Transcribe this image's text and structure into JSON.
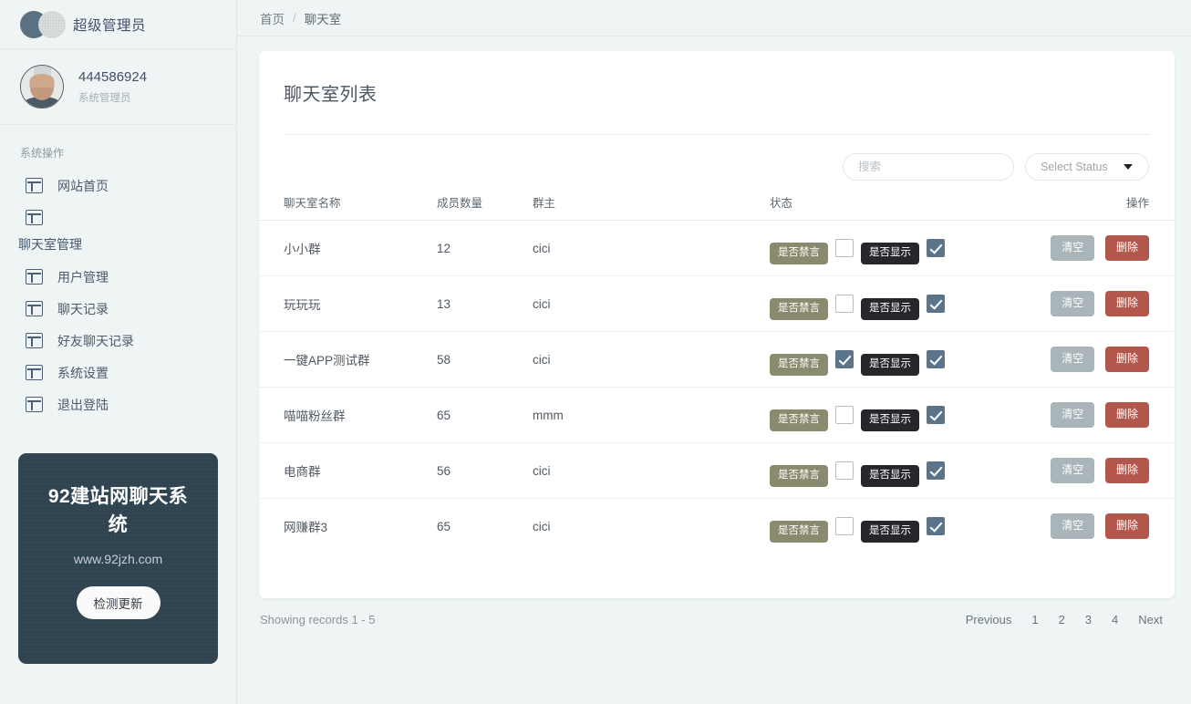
{
  "sidebar": {
    "brand": {
      "name": "超级管理员",
      "logo_icon": "two-circles-logo"
    },
    "user": {
      "id": "444586924",
      "role": "系统管理员",
      "avatar_icon": "user-photo-avatar"
    },
    "group1_title": "系统操作",
    "group2_title": "聊天室管理",
    "items_top": [
      {
        "label": "网站首页",
        "icon": "layout-icon"
      },
      {
        "label": "",
        "icon": "layout-icon"
      }
    ],
    "items_bottom": [
      {
        "label": "用户管理",
        "icon": "layout-icon"
      },
      {
        "label": "聊天记录",
        "icon": "layout-icon"
      },
      {
        "label": "好友聊天记录",
        "icon": "layout-icon"
      },
      {
        "label": "系统设置",
        "icon": "layout-icon"
      },
      {
        "label": "退出登陆",
        "icon": "layout-icon"
      }
    ],
    "promo": {
      "title": "92建站网聊天系统",
      "url": "www.92jzh.com",
      "button": "检测更新",
      "bg_color": "#2f4450"
    }
  },
  "breadcrumb": {
    "home": "首页",
    "sep": "/",
    "current": "聊天室"
  },
  "card": {
    "title": "聊天室列表",
    "search": {
      "value": "",
      "placeholder": "搜索"
    },
    "status_filter": {
      "selected": "Select Status",
      "icon": "chevron-down-icon"
    },
    "columns": [
      "聊天室名称",
      "成员数量",
      "群主",
      "状态",
      "操作"
    ],
    "row_actions": {
      "mute_label": "是否禁言",
      "show_label": "是否显示",
      "clear_label": "清空",
      "delete_label": "删除"
    },
    "rows": [
      {
        "name": "小小群",
        "members": "12",
        "owner": "cici",
        "muted": false,
        "shown": true
      },
      {
        "name": "玩玩玩",
        "members": "13",
        "owner": "cici",
        "muted": false,
        "shown": true
      },
      {
        "name": "一键APP测试群",
        "members": "58",
        "owner": "cici",
        "muted": true,
        "shown": true
      },
      {
        "name": "喵喵粉丝群",
        "members": "65",
        "owner": "mmm",
        "muted": false,
        "shown": true
      },
      {
        "name": "电商群",
        "members": "56",
        "owner": "cici",
        "muted": false,
        "shown": true
      },
      {
        "name": "网赚群3",
        "members": "65",
        "owner": "cici",
        "muted": false,
        "shown": true
      }
    ]
  },
  "footer": {
    "records_text": "Showing records 1 - 5",
    "previous": "Previous",
    "pages": [
      "1",
      "2",
      "3",
      "4"
    ],
    "next": "Next"
  },
  "colors": {
    "page_bg": "#eef5f4",
    "card_bg": "#ffffff",
    "promo_bg": "#2f4450",
    "mute_pill": "#8a8a6e",
    "show_pill": "#26272b",
    "checkbox_on": "#5b7489",
    "clear_btn": "#a9b5b9",
    "delete_btn": "#b3564c"
  }
}
